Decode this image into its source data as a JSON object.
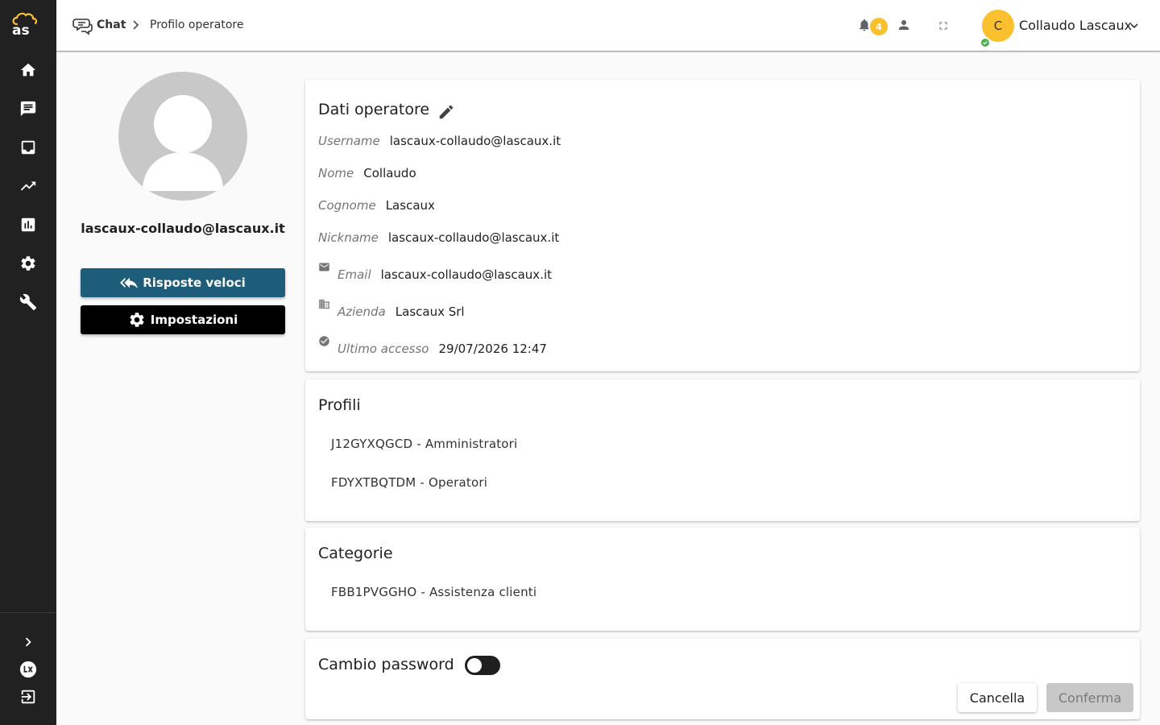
{
  "app": {
    "logo_text": "as",
    "accent_color": "#fbc02d",
    "sidebar_color": "#212121",
    "primary_button_color": "#1d5d7a"
  },
  "sidebar": {
    "items": [
      {
        "name": "home",
        "icon": "home-icon"
      },
      {
        "name": "chat",
        "icon": "chat-icon"
      },
      {
        "name": "inbox",
        "icon": "inbox-icon"
      },
      {
        "name": "trending",
        "icon": "trending-up-icon"
      },
      {
        "name": "reports",
        "icon": "bar-chart-icon"
      },
      {
        "name": "settings",
        "icon": "gear-icon"
      },
      {
        "name": "tools",
        "icon": "wrench-icon"
      }
    ],
    "bottom": [
      {
        "name": "expand",
        "icon": "chevron-right-icon"
      },
      {
        "name": "lascaux",
        "icon": "lascaux-logo-icon"
      },
      {
        "name": "logout",
        "icon": "logout-icon"
      }
    ]
  },
  "header": {
    "breadcrumb": {
      "root": "Chat",
      "current": "Profilo operatore"
    },
    "notifications_count": "4",
    "user": {
      "initial": "C",
      "name": "Collaudo Lascaux",
      "status": "online"
    }
  },
  "profile": {
    "username": "lascaux-collaudo@lascaux.it",
    "quick_replies_label": "Risposte veloci",
    "settings_label": "Impostazioni"
  },
  "operator_card": {
    "title": "Dati operatore",
    "fields": {
      "username": {
        "label": "Username",
        "value": "lascaux-collaudo@lascaux.it"
      },
      "nome": {
        "label": "Nome",
        "value": "Collaudo"
      },
      "cognome": {
        "label": "Cognome",
        "value": "Lascaux"
      },
      "nickname": {
        "label": "Nickname",
        "value": "lascaux-collaudo@lascaux.it"
      },
      "email": {
        "label": "Email",
        "value": "lascaux-collaudo@lascaux.it"
      },
      "azienda": {
        "label": "Azienda",
        "value": "Lascaux Srl"
      },
      "ultimo_accesso": {
        "label": "Ultimo accesso",
        "value": "29/07/2026 12:47"
      }
    }
  },
  "profiles_card": {
    "title": "Profili",
    "items": [
      "J12GYXQGCD - Amministratori",
      "FDYXTBQTDM - Operatori"
    ]
  },
  "categories_card": {
    "title": "Categorie",
    "items": [
      "FBB1PVGGHO - Assistenza clienti"
    ]
  },
  "password_card": {
    "title": "Cambio password",
    "toggle_on": false,
    "cancel_label": "Cancella",
    "confirm_label": "Conferma"
  }
}
